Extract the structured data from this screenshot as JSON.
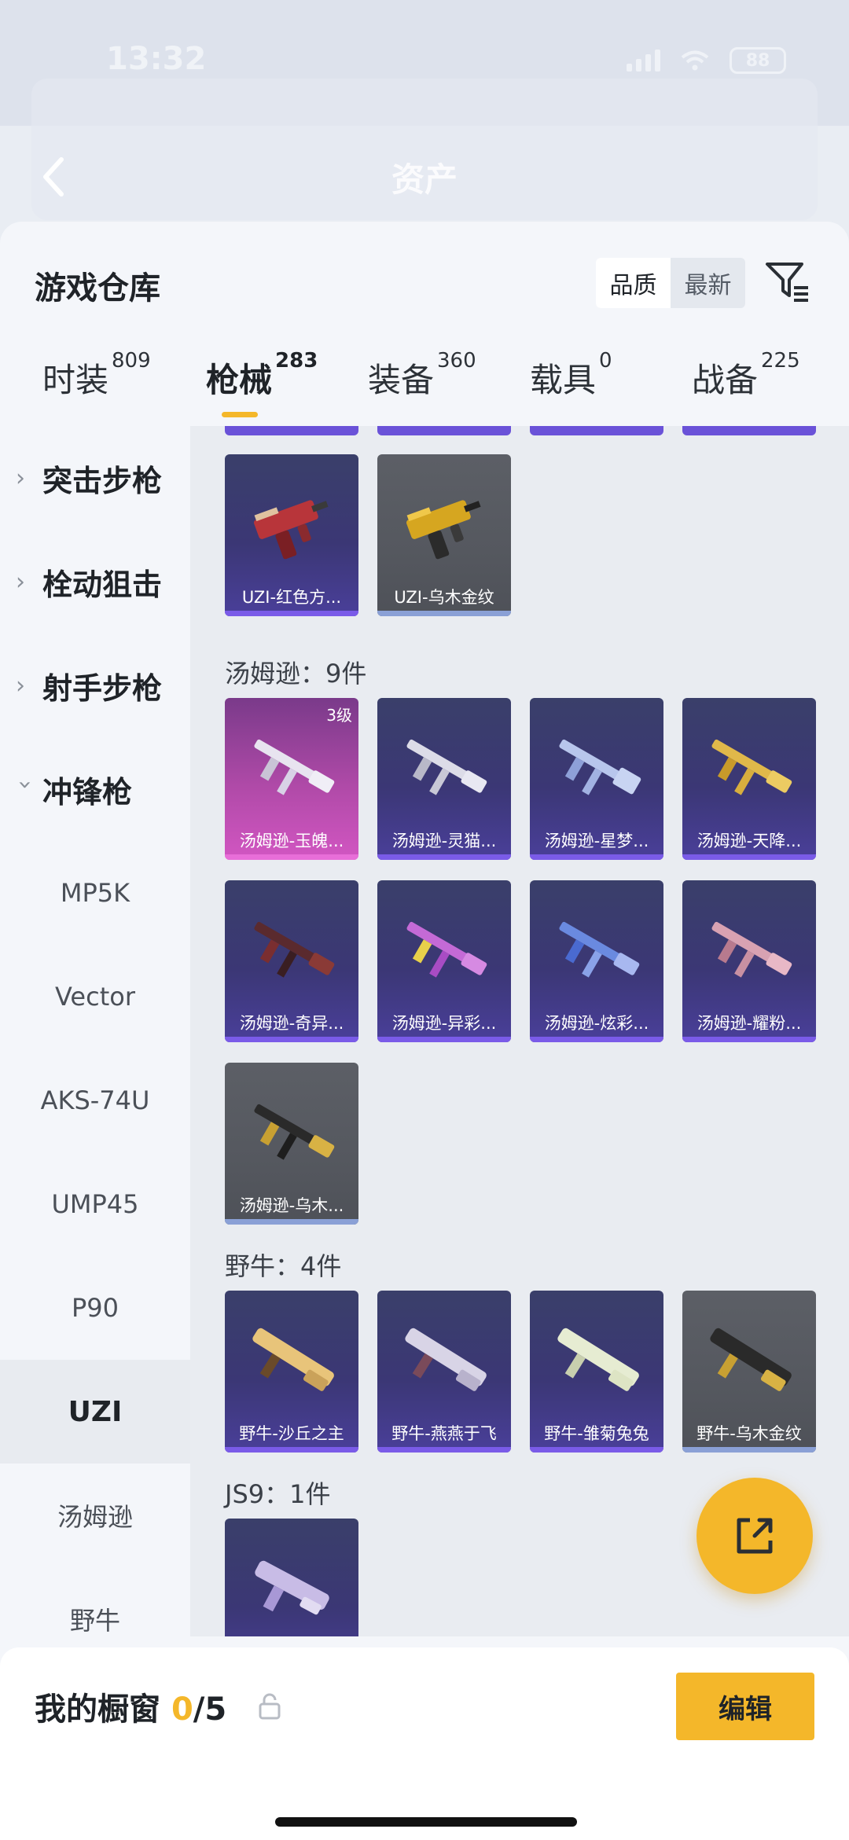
{
  "status": {
    "time": "13:32",
    "battery": "88"
  },
  "nav": {
    "title": "资产"
  },
  "header": {
    "title": "游戏仓库",
    "sort_quality": "品质",
    "sort_newest": "最新"
  },
  "tabs": [
    {
      "label": "时装",
      "count": "809"
    },
    {
      "label": "枪械",
      "count": "283"
    },
    {
      "label": "装备",
      "count": "360"
    },
    {
      "label": "载具",
      "count": "0"
    },
    {
      "label": "战备",
      "count": "225"
    }
  ],
  "sidebar": {
    "categories": [
      "突击步枪",
      "栓动狙击",
      "射手步枪",
      "冲锋枪"
    ],
    "subs": [
      "MP5K",
      "Vector",
      "AKS-74U",
      "UMP45",
      "P90",
      "UZI",
      "汤姆逊",
      "野牛"
    ]
  },
  "sections": {
    "uzi": {
      "items": [
        "UZI-红色方...",
        "UZI-乌木金纹"
      ]
    },
    "thompson": {
      "label": "汤姆逊：9件",
      "items": [
        "汤姆逊-玉魄...",
        "汤姆逊-灵猫...",
        "汤姆逊-星梦...",
        "汤姆逊-天降...",
        "汤姆逊-奇异...",
        "汤姆逊-异彩...",
        "汤姆逊-炫彩...",
        "汤姆逊-耀粉...",
        "汤姆逊-乌木..."
      ],
      "badge": "3级"
    },
    "bison": {
      "label": "野牛：4件",
      "items": [
        "野牛-沙丘之主",
        "野牛-燕燕于飞",
        "野牛-雏菊兔兔",
        "野牛-乌木金纹"
      ]
    },
    "js9": {
      "label": "JS9：1件"
    }
  },
  "bottom": {
    "title": "我的橱窗",
    "current": "0",
    "total": "/5",
    "edit": "编辑"
  },
  "colors": {
    "accent": "#f4b72a",
    "card_purple": "#3b3775",
    "card_gray": "#55585f",
    "card_pink": "#b04aa8"
  }
}
